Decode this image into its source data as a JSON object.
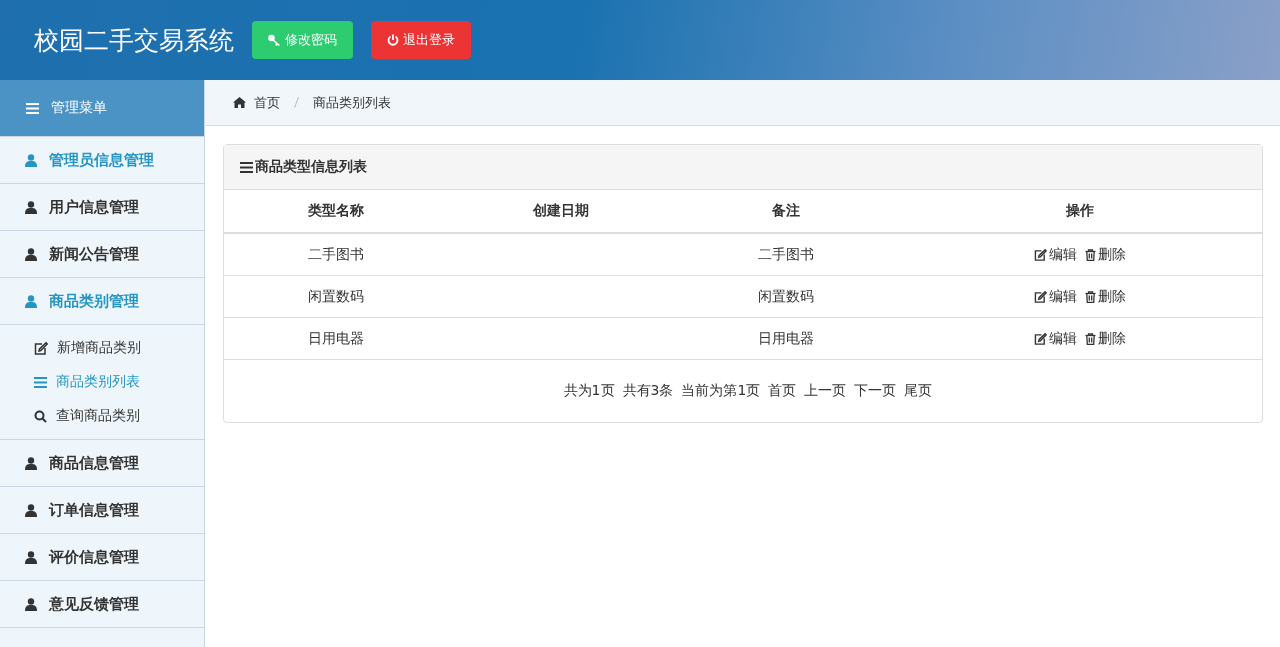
{
  "header": {
    "title": "校园二手交易系统",
    "buttons": [
      {
        "label": "修改密码",
        "kind": "password"
      },
      {
        "label": "退出登录",
        "kind": "logout"
      }
    ]
  },
  "sidebar": {
    "title": "管理菜单",
    "items": [
      {
        "label": "管理员信息管理",
        "selected": false,
        "highlighted": true
      },
      {
        "label": "用户信息管理",
        "selected": false,
        "highlighted": false
      },
      {
        "label": "新闻公告管理",
        "selected": false,
        "highlighted": false
      },
      {
        "label": "商品类别管理",
        "selected": false,
        "highlighted": true,
        "children": [
          {
            "label": "新增商品类别",
            "kind": "edit",
            "selected": false
          },
          {
            "label": "商品类别列表",
            "kind": "list",
            "selected": true
          },
          {
            "label": "查询商品类别",
            "kind": "search",
            "selected": false
          }
        ]
      },
      {
        "label": "商品信息管理",
        "selected": false,
        "highlighted": false
      },
      {
        "label": "订单信息管理",
        "selected": false,
        "highlighted": false
      },
      {
        "label": "评价信息管理",
        "selected": false,
        "highlighted": false
      },
      {
        "label": "意见反馈管理",
        "selected": false,
        "highlighted": false
      }
    ]
  },
  "breadcrumb": [
    "首页",
    "商品类别列表"
  ],
  "panel": {
    "title": "商品类型信息列表",
    "table": {
      "columns": [
        "类型名称",
        "创建日期",
        "备注",
        "操作"
      ],
      "rows": [
        {
          "name": "二手图书",
          "remark": "二手图书",
          "actions": [
            "编辑",
            "删除"
          ]
        },
        {
          "name": "闲置数码",
          "remark": "闲置数码",
          "actions": [
            "编辑",
            "删除"
          ]
        },
        {
          "name": "日用电器",
          "remark": "日用电器",
          "actions": [
            "编辑",
            "删除"
          ]
        }
      ]
    },
    "pagination": [
      "共为1页",
      "共有3条",
      "当前为第1页",
      "首页",
      "上一页",
      "下一页",
      "尾页"
    ]
  }
}
